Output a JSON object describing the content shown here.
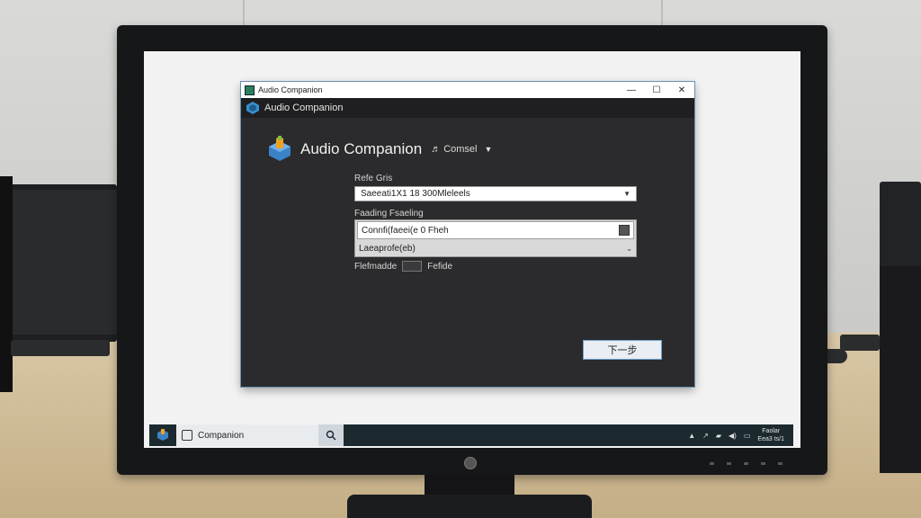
{
  "window": {
    "title": "Audio Companion",
    "controls": {
      "minimize": "—",
      "maximize": "☐",
      "close": "✕"
    }
  },
  "app_header": {
    "title": "Audio Companion"
  },
  "brand": {
    "name": "Audio Companion",
    "subtitle": "♬ Comsel",
    "caret": "▼"
  },
  "form": {
    "device_label": "Refe Gris",
    "device_value": "Saeeati1X1 18 300Mleleels",
    "format_label": "Faading Fsaeling",
    "list_items": [
      "Connfi(faeei(e 0 Fheh",
      "Laeaprofe(eb)"
    ],
    "checkbox_prefix": "Flefmadde",
    "checkbox_suffix": "Fefide"
  },
  "buttons": {
    "next": "下一步"
  },
  "taskbar": {
    "active_item": "Companion",
    "clock_line1": "Faolar",
    "clock_line2": "Eea3 ts/1"
  },
  "colors": {
    "window_bg": "#2b2b2d",
    "accent": "#6fa0c8",
    "taskbar_bg": "#1c2a30"
  }
}
